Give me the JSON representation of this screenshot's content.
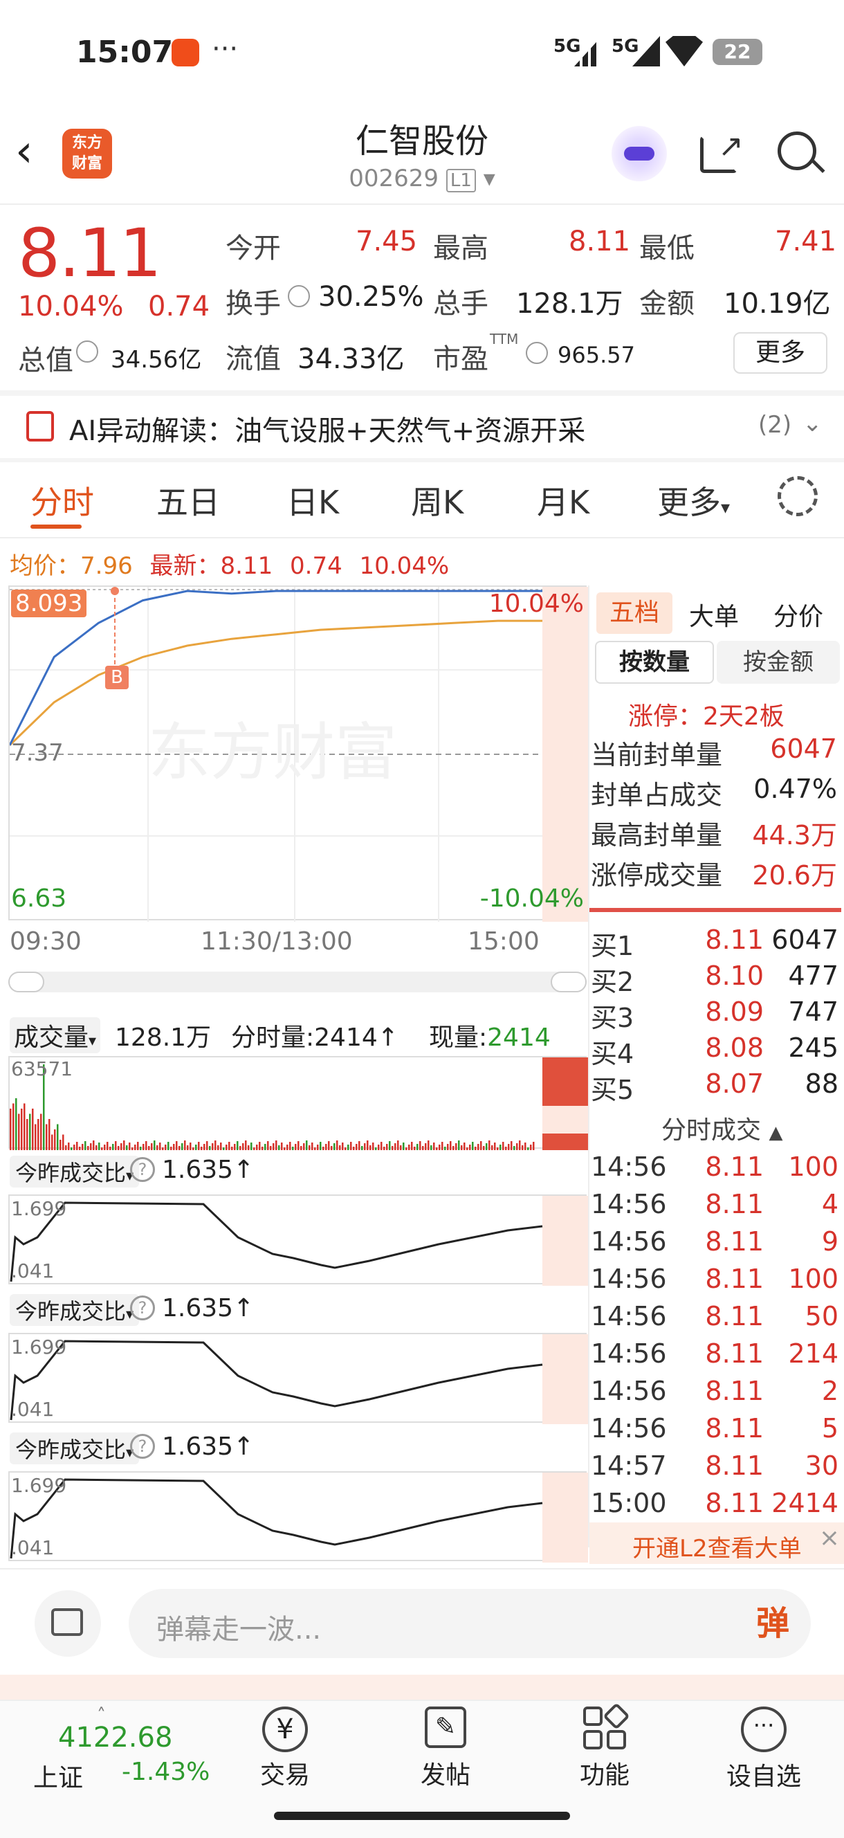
{
  "status_bar": {
    "time": "15:07",
    "signal1": "5G",
    "signal2": "5G",
    "battery": "22"
  },
  "header": {
    "stock_name": "仁智股份",
    "stock_code": "002629",
    "level": "L1",
    "logo_text": "东方财富"
  },
  "quote": {
    "price": "8.11",
    "change_pct": "10.04%",
    "change": "0.74",
    "open_label": "今开",
    "open": "7.45",
    "high_label": "最高",
    "high": "8.11",
    "low_label": "最低",
    "low": "7.41",
    "turnover_label": "换手",
    "turnover": "30.25%",
    "volume_label": "总手",
    "volume": "128.1万",
    "amount_label": "金额",
    "amount": "10.19亿",
    "mktcap_label": "总值",
    "mktcap": "34.56亿",
    "float_label": "流值",
    "float": "34.33亿",
    "pe_label": "市盈",
    "pe_sup": "TTM",
    "pe": "965.57",
    "more_label": "更多"
  },
  "ai_banner": {
    "text": "AI异动解读：油气设服+天然气+资源开采",
    "count": "(2)"
  },
  "tabs": [
    "分时",
    "五日",
    "日K",
    "周K",
    "月K",
    "更多"
  ],
  "chart_info": {
    "avg_label": "均价：",
    "avg": "7.96",
    "latest_label": "最新：",
    "latest": "8.11",
    "chg": "0.74",
    "chg_pct": "10.04%"
  },
  "chart": {
    "top_price": "8.093",
    "mid_price": "7.37",
    "low_price": "6.63",
    "top_pct": "10.04%",
    "low_pct": "-10.04%",
    "marker": "B",
    "times": [
      "09:30",
      "11:30/13:00",
      "15:00"
    ],
    "watermark": "东方财富"
  },
  "chart_data": {
    "type": "line",
    "title": "",
    "ylim": [
      6.63,
      8.11
    ],
    "x": [
      "09:30",
      "11:30/13:00",
      "15:00"
    ],
    "series": [
      {
        "values": [
          7.41,
          7.8,
          7.95,
          8.05,
          8.11,
          8.08,
          8.11,
          8.1,
          8.11,
          8.11,
          8.11,
          8.11,
          8.11
        ]
      },
      {
        "values": [
          7.41,
          7.6,
          7.72,
          7.8,
          7.85,
          7.88,
          7.9,
          7.92,
          7.93,
          7.94,
          7.95,
          7.96,
          7.96
        ]
      }
    ]
  },
  "volume_bar": {
    "label": "成交量",
    "total": "128.1万",
    "period_label": "分时量:",
    "period": "2414",
    "now_label": "现量:",
    "now": "2414",
    "max": "63571"
  },
  "ratio_panels": [
    {
      "label": "今昨成交比",
      "value": "1.635",
      "top": "1.699",
      "bottom": ".041"
    },
    {
      "label": "今昨成交比",
      "value": "1.635",
      "top": "1.699",
      "bottom": ".041"
    },
    {
      "label": "今昨成交比",
      "value": "1.635",
      "top": "1.699",
      "bottom": ".041"
    }
  ],
  "right_panel": {
    "tabs": [
      "五档",
      "大单",
      "分价"
    ],
    "toggle": [
      "按数量",
      "按金额"
    ],
    "limit_title": "涨停：2天2板",
    "limit_rows": [
      {
        "k": "当前封单量",
        "v": "6047"
      },
      {
        "k": "封单占成交",
        "v": "0.47%"
      },
      {
        "k": "最高封单量",
        "v": "44.3万"
      },
      {
        "k": "涨停成交量",
        "v": "20.6万"
      }
    ],
    "bids": [
      {
        "k": "买1",
        "p": "8.11",
        "v": "6047"
      },
      {
        "k": "买2",
        "p": "8.10",
        "v": "477"
      },
      {
        "k": "买3",
        "p": "8.09",
        "v": "747"
      },
      {
        "k": "买4",
        "p": "8.08",
        "v": "245"
      },
      {
        "k": "买5",
        "p": "8.07",
        "v": "88"
      }
    ],
    "ticks_title": "分时成交",
    "ticks": [
      {
        "t": "14:56",
        "p": "8.11",
        "v": "100"
      },
      {
        "t": "14:56",
        "p": "8.11",
        "v": "4"
      },
      {
        "t": "14:56",
        "p": "8.11",
        "v": "9"
      },
      {
        "t": "14:56",
        "p": "8.11",
        "v": "100"
      },
      {
        "t": "14:56",
        "p": "8.11",
        "v": "50"
      },
      {
        "t": "14:56",
        "p": "8.11",
        "v": "214"
      },
      {
        "t": "14:56",
        "p": "8.11",
        "v": "2"
      },
      {
        "t": "14:56",
        "p": "8.11",
        "v": "5"
      },
      {
        "t": "14:57",
        "p": "8.11",
        "v": "30"
      },
      {
        "t": "15:00",
        "p": "8.11",
        "v": "2414"
      }
    ],
    "l2_label": "开通L2查看大单"
  },
  "comment": {
    "placeholder": "弹幕走一波...",
    "button": "弹"
  },
  "bottom_bar": {
    "index_value": "4122.68",
    "index_name": "上证",
    "index_change": "-1.43%",
    "items": [
      "交易",
      "发帖",
      "功能",
      "设自选"
    ]
  }
}
